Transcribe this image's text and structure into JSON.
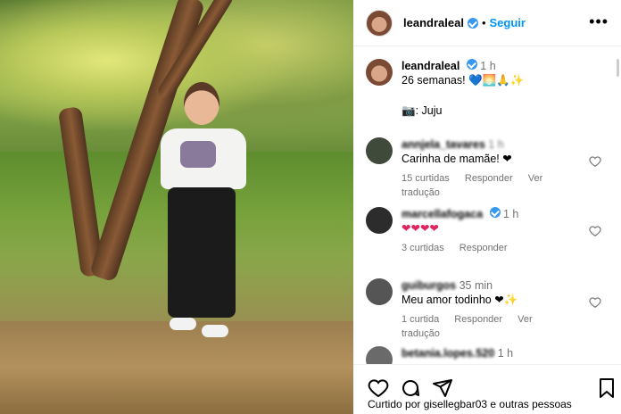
{
  "post": {
    "author": "leandraleal",
    "follow_label": "Seguir",
    "more_label": "•••"
  },
  "caption": {
    "author": "leandraleal",
    "time": "1 h",
    "text_line1": "26 semanas! 💙🌅🙏✨",
    "text_line2": "📷: Juju"
  },
  "comments": [
    {
      "user": "annjela_tavares",
      "time": "1 h",
      "text": "Carinha de mamãe! ❤",
      "likes": "15 curtidas",
      "reply": "Responder",
      "translate": "Ver tradução"
    },
    {
      "user": "marcellafogaca",
      "time": "1 h",
      "text": "❤❤❤❤",
      "likes": "3 curtidas",
      "reply": "Responder",
      "translate": ""
    },
    {
      "user": "guiburgos",
      "time": "35 min",
      "text": "Meu amor todinho ❤✨",
      "likes": "1 curtida",
      "reply": "Responder",
      "translate": "Ver tradução"
    },
    {
      "user": "betania.lopes.520",
      "time": "1 h",
      "text": "",
      "likes": "",
      "reply": "",
      "translate": ""
    }
  ],
  "footer": {
    "liked_by": "Curtido por gisellegbar03 e outras pessoas"
  },
  "icons": [
    "heart-icon",
    "comment-icon",
    "share-icon",
    "save-icon",
    "more-icon",
    "verified-icon"
  ],
  "colors": {
    "accent": "#0095f6",
    "verified": "#3897f0",
    "muted": "#737373"
  }
}
